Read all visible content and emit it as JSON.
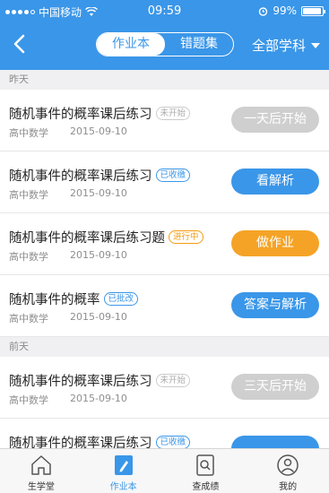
{
  "status_bar": {
    "carrier": "中国移动",
    "time": "09:59",
    "battery": "99%"
  },
  "nav": {
    "tabs": [
      {
        "label": "作业本",
        "active": true
      },
      {
        "label": "错题集",
        "active": false
      }
    ],
    "subject_filter": "全部学科"
  },
  "sections": [
    {
      "label": "昨天",
      "items": [
        {
          "title": "随机事件的概率课后练习",
          "tag": "未开始",
          "subject": "高中数学",
          "date": "2015-09-10",
          "action": "一天后开始"
        },
        {
          "title": "随机事件的概率课后练习",
          "tag": "已收缴",
          "subject": "高中数学",
          "date": "2015-09-10",
          "action": "看解析"
        },
        {
          "title": "随机事件的概率课后练习题",
          "tag": "进行中",
          "subject": "高中数学",
          "date": "2015-09-10",
          "action": "做作业"
        },
        {
          "title": "随机事件的概率",
          "tag": "已批改",
          "subject": "高中数学",
          "date": "2015-09-10",
          "action": "答案与解析"
        }
      ]
    },
    {
      "label": "前天",
      "items": [
        {
          "title": "随机事件的概率课后练习",
          "tag": "未开始",
          "subject": "高中数学",
          "date": "2015-09-10",
          "action": "三天后开始"
        },
        {
          "title": "随机事件的概率课后练习",
          "tag": "已收缴",
          "subject": "",
          "date": "",
          "action": ""
        }
      ]
    }
  ],
  "tabbar": [
    {
      "label": "生学堂",
      "icon": "home-icon"
    },
    {
      "label": "作业本",
      "icon": "homework-icon",
      "active": true
    },
    {
      "label": "查成绩",
      "icon": "search-grades-icon"
    },
    {
      "label": "我的",
      "icon": "profile-icon"
    }
  ],
  "colors": {
    "primary": "#3a96e8",
    "orange": "#f5a326",
    "disabled": "#cfcfcf"
  }
}
